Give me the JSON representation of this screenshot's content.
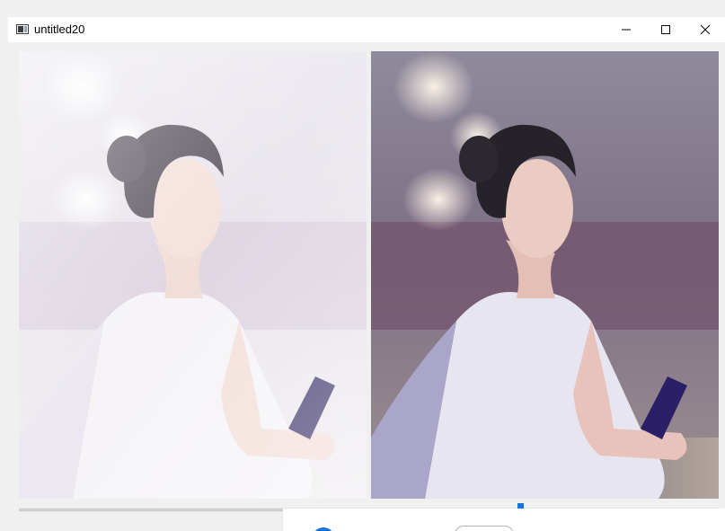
{
  "window": {
    "title": "untitled20",
    "controls": {
      "minimize_icon": "minimize-icon",
      "maximize_icon": "maximize-icon",
      "close_icon": "close-icon"
    }
  },
  "images": {
    "left": {
      "description_name": "processed-portrait"
    },
    "right": {
      "description_name": "original-portrait"
    }
  },
  "colors": {
    "accent": "#1a73d9",
    "titlebar_bg": "#ffffff",
    "client_bg": "#f0f0f0"
  },
  "scroll": {
    "position_fraction": 0.0
  }
}
